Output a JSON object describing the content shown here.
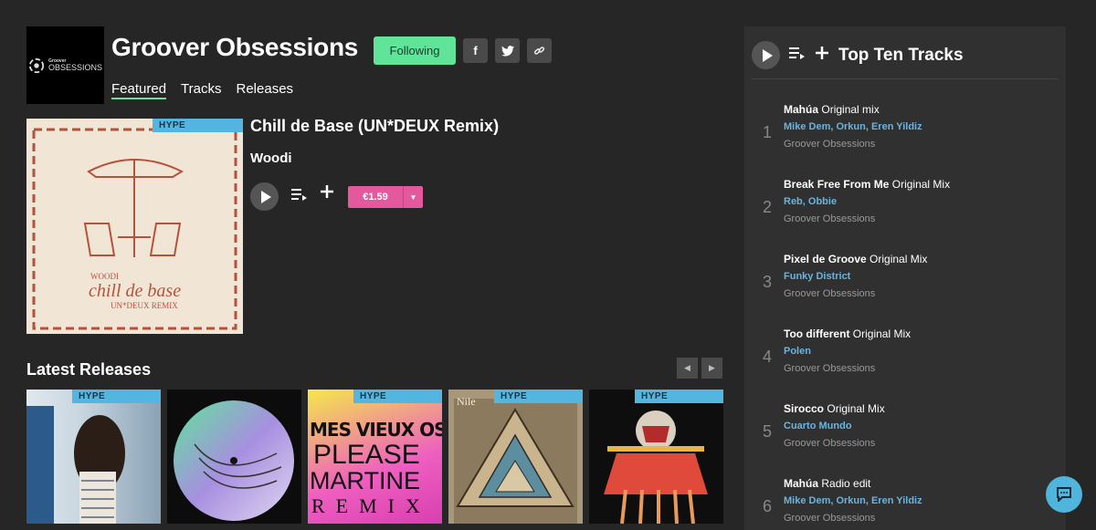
{
  "header": {
    "logo_small": "Groover",
    "logo_text": "OBSESSIONS",
    "title": "Groover Obsessions",
    "following_label": "Following",
    "social": {
      "facebook": "f",
      "twitter": "t",
      "link": "⛓"
    }
  },
  "nav": {
    "tabs": [
      {
        "label": "Featured"
      },
      {
        "label": "Tracks"
      },
      {
        "label": "Releases"
      }
    ]
  },
  "featured": {
    "hype": "HYPE",
    "title": "Chill de Base (UN*DEUX Remix)",
    "artist": "Woodi",
    "price": "€1.59",
    "cover_text": {
      "artist": "WOODI",
      "title": "chill de base",
      "sub": "UN*DEUX REMIX"
    }
  },
  "latest": {
    "title": "Latest Releases",
    "prev": "◀",
    "next": "▶",
    "items": [
      {
        "hype": "HYPE"
      },
      {
        "hype": ""
      },
      {
        "hype": "HYPE",
        "cover_lines": [
          "MES VIEUX OS",
          "PLEASE",
          "MARTINE",
          "REMIX"
        ]
      },
      {
        "hype": "HYPE",
        "cover_lines": [
          "Nile"
        ]
      },
      {
        "hype": "HYPE"
      }
    ]
  },
  "sidebar": {
    "title": "Top Ten Tracks",
    "tracks": [
      {
        "num": "1",
        "title": "Mahúa",
        "mix": "Original mix",
        "artists": "Mike Dem, Orkun, Eren Yildiz",
        "label": "Groover Obsessions"
      },
      {
        "num": "2",
        "title": "Break Free From Me",
        "mix": "Original Mix",
        "artists": "Reb, Obbie",
        "label": "Groover Obsessions"
      },
      {
        "num": "3",
        "title": "Pixel de Groove",
        "mix": "Original Mix",
        "artists": "Funky District",
        "label": "Groover Obsessions"
      },
      {
        "num": "4",
        "title": "Too different",
        "mix": "Original Mix",
        "artists": "Polen",
        "label": "Groover Obsessions"
      },
      {
        "num": "5",
        "title": "Sirocco",
        "mix": "Original Mix",
        "artists": "Cuarto Mundo",
        "label": "Groover Obsessions"
      },
      {
        "num": "6",
        "title": "Mahúa",
        "mix": "Radio edit",
        "artists": "Mike Dem, Orkun, Eren Yildiz",
        "label": "Groover Obsessions"
      }
    ]
  },
  "colors": {
    "accent": "#5fe49a",
    "price": "#e4589e",
    "hype": "#52b6e0",
    "artist_link": "#6ab4e0"
  },
  "icons": {
    "play": "play-icon",
    "queue": "add-to-queue-icon",
    "add": "plus-icon",
    "chat": "chat-icon"
  }
}
